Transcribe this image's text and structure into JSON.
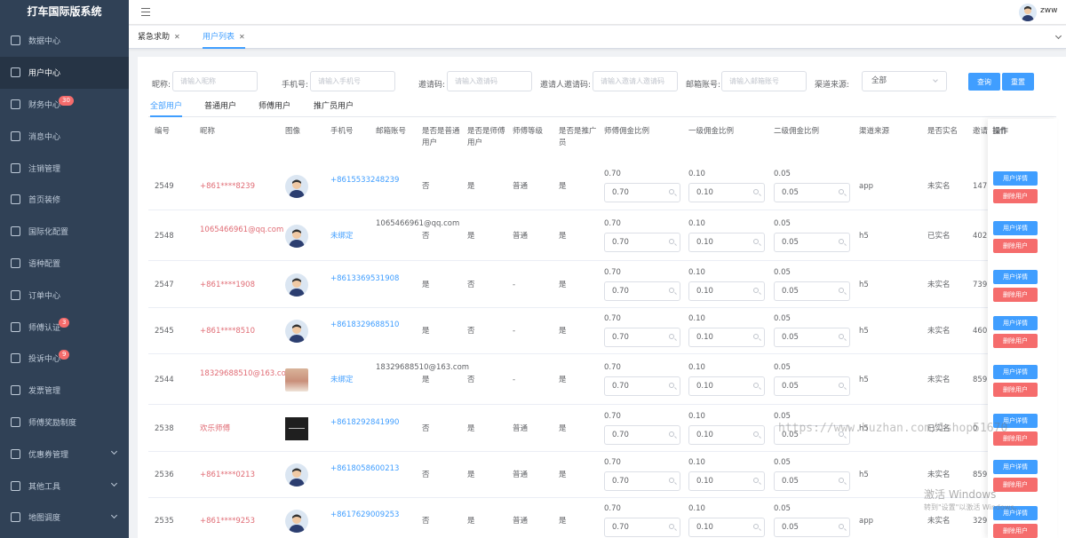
{
  "app_title": "打车国际版系统",
  "user_name": "zww",
  "sidebar": {
    "items": [
      {
        "label": "数据中心",
        "icon": "dashboard-icon",
        "badge": "",
        "arrow": false,
        "active": false
      },
      {
        "label": "用户中心",
        "icon": "user-icon",
        "badge": "",
        "arrow": false,
        "active": true
      },
      {
        "label": "财务中心",
        "icon": "wallet-icon",
        "badge": "30",
        "arrow": false,
        "active": false
      },
      {
        "label": "消息中心",
        "icon": "message-icon",
        "badge": "",
        "arrow": false,
        "active": false
      },
      {
        "label": "注销管理",
        "icon": "layers-icon",
        "badge": "",
        "arrow": false,
        "active": false
      },
      {
        "label": "首页装修",
        "icon": "box-icon",
        "badge": "",
        "arrow": false,
        "active": false
      },
      {
        "label": "国际化配置",
        "icon": "document-icon",
        "badge": "",
        "arrow": false,
        "active": false
      },
      {
        "label": "语种配置",
        "icon": "gear-icon",
        "badge": "",
        "arrow": false,
        "active": false
      },
      {
        "label": "订单中心",
        "icon": "order-icon",
        "badge": "",
        "arrow": false,
        "active": false
      },
      {
        "label": "师傅认证",
        "icon": "box-icon",
        "badge": "3",
        "arrow": false,
        "active": false
      },
      {
        "label": "投诉中心",
        "icon": "user-icon",
        "badge": "9",
        "arrow": false,
        "active": false
      },
      {
        "label": "发票管理",
        "icon": "cloud-icon",
        "badge": "",
        "arrow": false,
        "active": false
      },
      {
        "label": "师傅奖励制度",
        "icon": "document-icon",
        "badge": "",
        "arrow": false,
        "active": false
      },
      {
        "label": "优惠券管理",
        "icon": "box-icon",
        "badge": "",
        "arrow": true,
        "active": false
      },
      {
        "label": "其他工具",
        "icon": "wallet-icon",
        "badge": "",
        "arrow": true,
        "active": false
      },
      {
        "label": "地图调度",
        "icon": "location-icon",
        "badge": "",
        "arrow": true,
        "active": false
      }
    ]
  },
  "tags": [
    {
      "label": "紧急求助",
      "active": false
    },
    {
      "label": "用户列表",
      "active": true
    }
  ],
  "filters": {
    "nickname_label": "昵称:",
    "nickname_placeholder": "请输入昵称",
    "phone_label": "手机号:",
    "phone_placeholder": "请输入手机号",
    "invite_label": "邀请码:",
    "invite_placeholder": "请输入邀请码",
    "inviter_label": "邀请人邀请码:",
    "inviter_placeholder": "请输入邀请人邀请码",
    "email_label": "邮箱账号:",
    "email_placeholder": "请输入邮箱账号",
    "channel_label": "渠道来源:",
    "channel_value": "全部",
    "query_button": "查询",
    "reset_button": "重置"
  },
  "tabs": [
    "全部用户",
    "普通用户",
    "师傅用户",
    "推广员用户"
  ],
  "table": {
    "columns": [
      "编号",
      "昵称",
      "图像",
      "手机号",
      "邮箱账号",
      "是否是普通用户",
      "是否是师傅用户",
      "师傅等级",
      "是否是推广员",
      "师傅佣金比例",
      "一级佣金比例",
      "二级佣金比例",
      "渠道来源",
      "是否实名",
      "邀请",
      "操作"
    ],
    "rows": [
      {
        "id": "2549",
        "nickname": "+861****8239",
        "avatar": "default",
        "phone": "+8615533248239",
        "email": "",
        "normal": "否",
        "driver": "是",
        "level": "普通",
        "promoter": "是",
        "r1": "0.70",
        "r2": "0.10",
        "r3": "0.05",
        "channel": "app",
        "verified": "未实名",
        "invite": "147"
      },
      {
        "id": "2548",
        "nickname": "1065466961@qq.com",
        "avatar": "default",
        "phone": "未绑定",
        "email": "1065466961@qq.com",
        "normal": "否",
        "driver": "是",
        "level": "普通",
        "promoter": "是",
        "r1": "0.70",
        "r2": "0.10",
        "r3": "0.05",
        "channel": "h5",
        "verified": "已实名",
        "invite": "402"
      },
      {
        "id": "2547",
        "nickname": "+861****1908",
        "avatar": "default",
        "phone": "+8613369531908",
        "email": "",
        "normal": "是",
        "driver": "否",
        "level": "-",
        "promoter": "是",
        "r1": "0.70",
        "r2": "0.10",
        "r3": "0.05",
        "channel": "h5",
        "verified": "未实名",
        "invite": "739"
      },
      {
        "id": "2545",
        "nickname": "+861****8510",
        "avatar": "default",
        "phone": "+8618329688510",
        "email": "",
        "normal": "是",
        "driver": "否",
        "level": "-",
        "promoter": "是",
        "r1": "0.70",
        "r2": "0.10",
        "r3": "0.05",
        "channel": "h5",
        "verified": "未实名",
        "invite": "460"
      },
      {
        "id": "2544",
        "nickname": "18329688510@163.com",
        "avatar": "photo",
        "phone": "未绑定",
        "email": "18329688510@163.com",
        "normal": "是",
        "driver": "否",
        "level": "-",
        "promoter": "是",
        "r1": "0.70",
        "r2": "0.10",
        "r3": "0.05",
        "channel": "h5",
        "verified": "未实名",
        "invite": "859"
      },
      {
        "id": "2538",
        "nickname": "欢乐师傅",
        "avatar": "dark",
        "phone": "+8618292841990",
        "email": "",
        "normal": "否",
        "driver": "是",
        "level": "普通",
        "promoter": "是",
        "r1": "0.70",
        "r2": "0.10",
        "r3": "0.05",
        "channel": "h5",
        "verified": "已实名",
        "invite": "0"
      },
      {
        "id": "2536",
        "nickname": "+861****0213",
        "avatar": "default",
        "phone": "+8618058600213",
        "email": "",
        "normal": "否",
        "driver": "是",
        "level": "普通",
        "promoter": "是",
        "r1": "0.70",
        "r2": "0.10",
        "r3": "0.05",
        "channel": "h5",
        "verified": "未实名",
        "invite": "859"
      },
      {
        "id": "2535",
        "nickname": "+861****9253",
        "avatar": "default",
        "phone": "+8617629009253",
        "email": "",
        "normal": "否",
        "driver": "是",
        "level": "普通",
        "promoter": "是",
        "r1": "0.70",
        "r2": "0.10",
        "r3": "0.05",
        "channel": "app",
        "verified": "未实名",
        "invite": "329"
      }
    ],
    "detail_button": "用户详情",
    "delete_button": "删除用户"
  },
  "watermark": "https://www.huzhan.com/1shop51670",
  "windows_activation": {
    "title": "激活 Windows",
    "subtitle": "转到\"设置\"以激活 Windows。"
  },
  "colors": {
    "sidebar_bg": "#304156",
    "primary": "#409eff",
    "danger": "#f56c6c",
    "nickname": "#e06c75"
  }
}
